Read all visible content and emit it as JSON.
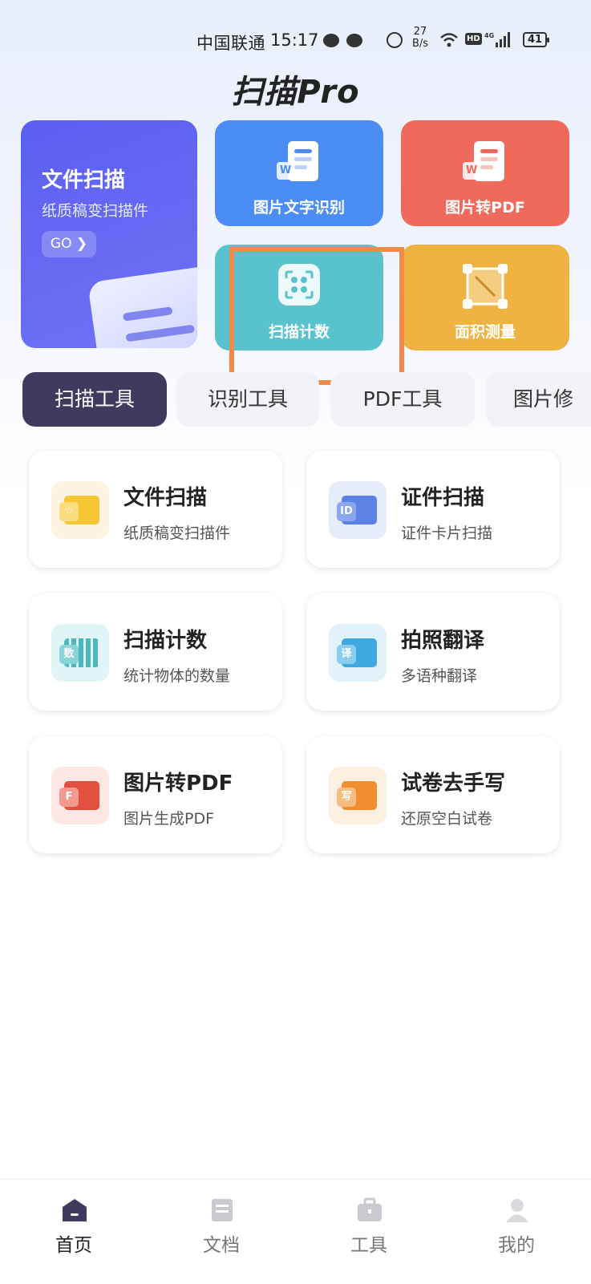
{
  "status_bar": {
    "carrier": "中国联通",
    "time": "15:17",
    "net_speed_value": "27",
    "net_speed_unit": "B/s",
    "hd": "HD",
    "network": "4G",
    "battery": "41"
  },
  "app": {
    "logo": "扫描Pro"
  },
  "hero": {
    "title": "文件扫描",
    "subtitle": "纸质稿变扫描件",
    "go_label": "GO ❯"
  },
  "tools": [
    {
      "label": "图片文字识别",
      "icon": "word-doc-icon",
      "color": "#4b8cf5"
    },
    {
      "label": "图片转PDF",
      "icon": "word-doc-icon",
      "color": "#ef6a5d"
    },
    {
      "label": "扫描计数",
      "icon": "scan-count-icon",
      "color": "#58c3cf"
    },
    {
      "label": "面积测量",
      "icon": "area-measure-icon",
      "color": "#efb341"
    }
  ],
  "category_tabs": [
    {
      "label": "扫描工具",
      "active": true
    },
    {
      "label": "识别工具",
      "active": false
    },
    {
      "label": "PDF工具",
      "active": false
    },
    {
      "label": "图片修",
      "active": false
    }
  ],
  "features": [
    {
      "title": "文件扫描",
      "subtitle": "纸质稿变扫描件",
      "icon": "file-scan-icon"
    },
    {
      "title": "证件扫描",
      "subtitle": "证件卡片扫描",
      "icon": "id-card-icon",
      "tag": "ID"
    },
    {
      "title": "扫描计数",
      "subtitle": "统计物体的数量",
      "icon": "count-grid-icon",
      "tag": "数"
    },
    {
      "title": "拍照翻译",
      "subtitle": "多语种翻译",
      "icon": "photo-translate-icon",
      "tag": "译"
    },
    {
      "title": "图片转PDF",
      "subtitle": "图片生成PDF",
      "icon": "pdf-icon",
      "tag": "F"
    },
    {
      "title": "试卷去手写",
      "subtitle": "还原空白试卷",
      "icon": "exam-paper-icon",
      "tag": "写"
    }
  ],
  "nav": [
    {
      "label": "首页",
      "active": true,
      "icon": "home-icon"
    },
    {
      "label": "文档",
      "active": false,
      "icon": "document-icon"
    },
    {
      "label": "工具",
      "active": false,
      "icon": "toolbox-icon"
    },
    {
      "label": "我的",
      "active": false,
      "icon": "profile-icon"
    }
  ],
  "colors": {
    "accent_dark": "#3e3b5f",
    "highlight": "#f0894a",
    "hero": "#5b5ff0"
  }
}
